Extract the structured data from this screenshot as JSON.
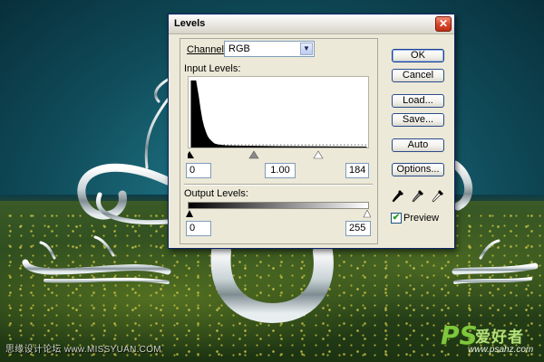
{
  "dialog": {
    "title": "Levels",
    "close_glyph": "✕",
    "channel": {
      "label": "Channel:",
      "value": "RGB",
      "arrow_glyph": "▼"
    },
    "input_levels": {
      "label": "Input Levels:",
      "black": "0",
      "gamma": "1.00",
      "white": "184"
    },
    "output_levels": {
      "label": "Output Levels:",
      "black": "0",
      "white": "255"
    },
    "buttons": {
      "ok": "OK",
      "cancel": "Cancel",
      "load": "Load...",
      "save": "Save...",
      "auto": "Auto",
      "options": "Options..."
    },
    "eyedroppers": [
      "black-eyedropper-icon",
      "gray-eyedropper-icon",
      "white-eyedropper-icon"
    ],
    "preview": {
      "label": "Preview",
      "checked": true,
      "check_glyph": "✔"
    }
  },
  "watermark": {
    "left_text": "思缘设计论坛 www.MISSYUAN.COM"
  },
  "logo": {
    "ps": "PS",
    "cn": "爱好者",
    "url": "www.psahz.com"
  },
  "colors": {
    "sky": "#104c5a",
    "meadow": "#2f4d1f",
    "dialog_bg": "#ece9d8",
    "close_red": "#d6452a",
    "titlebar": "#e6e4de"
  }
}
